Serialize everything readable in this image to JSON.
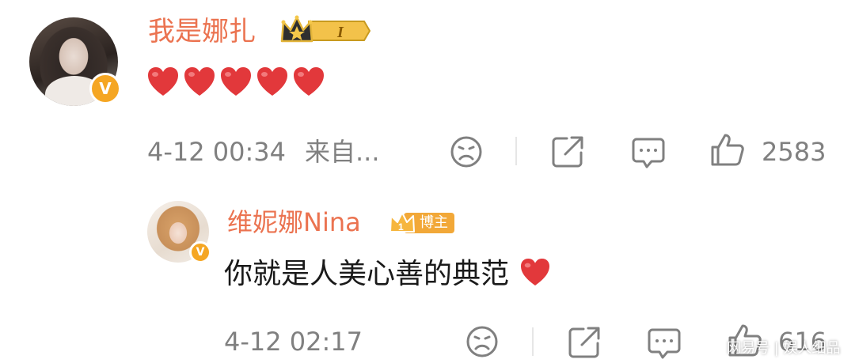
{
  "comment": {
    "username": "我是娜扎",
    "level_badge": "I",
    "content": "❤️❤️❤️❤️❤️",
    "timestamp": "4-12 00:34",
    "source": "来自...",
    "like_count": "2583"
  },
  "reply": {
    "username": "维妮娜Nina",
    "badge_label": "博主",
    "content": "你就是人美心善的典范",
    "timestamp": "4-12 02:17",
    "like_count": "616"
  },
  "watermark": "网易号 | 娱人细品",
  "colors": {
    "username": "#eb7350",
    "verified": "#f5a623",
    "heart": "#e2383b",
    "meta": "#808080"
  },
  "icons": [
    "avatar",
    "verified-v-icon",
    "crown-level-badge",
    "dislike-face-icon",
    "share-icon",
    "comment-icon",
    "thumbs-up-icon",
    "heart-icon"
  ]
}
